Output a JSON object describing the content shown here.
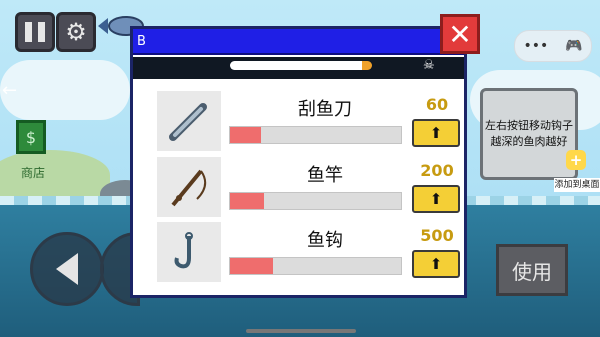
{
  "panel": {
    "title": "B",
    "close_icon": "close-x-icon",
    "items": [
      {
        "name": "刮鱼刀",
        "price": "60",
        "level": 0.18,
        "icon": "scraper-knife-icon"
      },
      {
        "name": "鱼竿",
        "price": "200",
        "level": 0.2,
        "icon": "fishing-rod-icon"
      },
      {
        "name": "鱼钩",
        "price": "500",
        "level": 0.25,
        "icon": "fish-hook-icon"
      }
    ],
    "upgrade_icon": "up-arrow-icon"
  },
  "hud": {
    "pause_icon": "pause-icon",
    "settings_icon": "gear-icon",
    "shop_label": "商店",
    "hint_text": "左右按钮移动钩子 越深的鱼肉越好",
    "add_to_desktop": "添加到桌面",
    "use_label": "使用",
    "menu_more": "•••"
  },
  "colors": {
    "titlebar": "#1f1fe6",
    "close": "#e23b3b",
    "upgrade_button": "#f4cf36",
    "level_fill": "#ef6d6d",
    "price_text": "#c79b11"
  }
}
